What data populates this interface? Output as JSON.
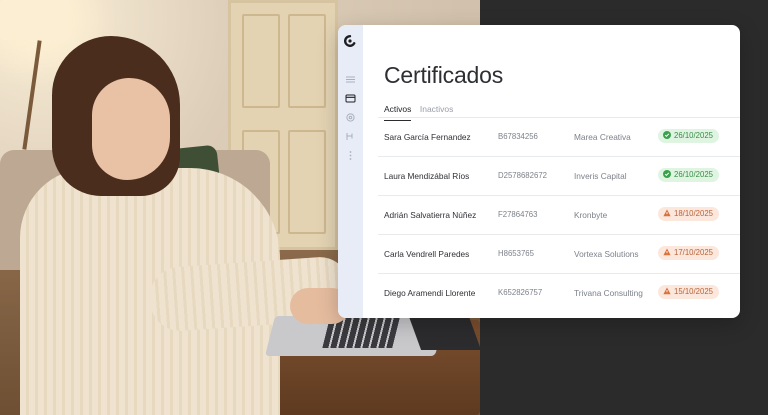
{
  "photo": {
    "description_icon": "person-at-laptop-photo"
  },
  "app": {
    "title": "Certificados",
    "tabs": [
      {
        "label": "Activos",
        "active": true
      },
      {
        "label": "Inactivos",
        "active": false
      }
    ],
    "rail_icons": [
      "logo-icon",
      "menu-icon",
      "card-icon",
      "gear-icon",
      "flow-icon",
      "more-icon"
    ],
    "rows": [
      {
        "name": "Sara García Fernandez",
        "id": "B67834256",
        "company": "Marea Creativa",
        "date": "26/10/2025",
        "status": "ok"
      },
      {
        "name": "Laura Mendizábal Ríos",
        "id": "D2578682672",
        "company": "Inveris Capital",
        "date": "26/10/2025",
        "status": "ok"
      },
      {
        "name": "Adrián Salvatierra Núñez",
        "id": "F27864763",
        "company": "Kronbyte",
        "date": "18/10/2025",
        "status": "warn"
      },
      {
        "name": "Carla Vendrell Paredes",
        "id": "H8653765",
        "company": "Vortexa Solutions",
        "date": "17/10/2025",
        "status": "warn"
      },
      {
        "name": "Diego Aramendi Llorente",
        "id": "K652826757",
        "company": "Trivana Consulting",
        "date": "15/10/2025",
        "status": "warn"
      }
    ],
    "colors": {
      "ok": "#3a8b46",
      "warn": "#b8643a",
      "rail": "#e8ecf6"
    }
  }
}
